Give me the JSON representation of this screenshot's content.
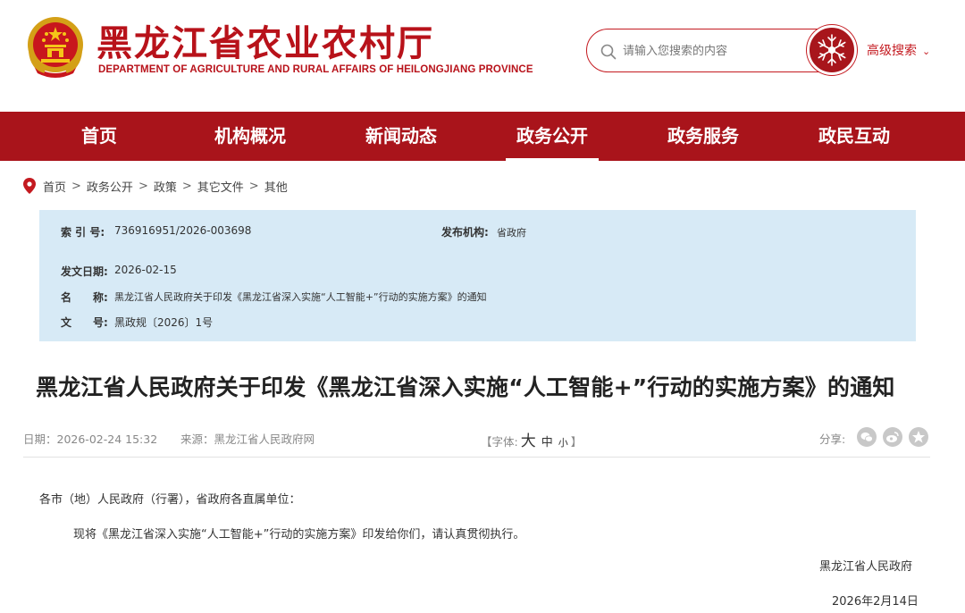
{
  "header": {
    "title": "黑龙江省农业农村厅",
    "subtitle": "DEPARTMENT OF AGRICULTURE AND RURAL AFFAIRS OF HEILONGJIANG PROVINCE",
    "emblem_icon": "national-emblem-icon",
    "search_placeholder": "请输入您搜索的内容",
    "advanced_search": "高级搜索",
    "brand_color": "#a9141b"
  },
  "nav": {
    "items": [
      {
        "label": "首页"
      },
      {
        "label": "机构概况"
      },
      {
        "label": "新闻动态"
      },
      {
        "label": "政务公开"
      },
      {
        "label": "政务服务"
      },
      {
        "label": "政民互动"
      }
    ],
    "active": "政务公开"
  },
  "breadcrumb": [
    "首页",
    "政务公开",
    "政策",
    "其它文件",
    "其他"
  ],
  "info": {
    "index_label": "索 引 号:",
    "index_value": "736916951/2026-003698",
    "publisher_label": "发布机构:",
    "publisher_value": "省政府",
    "date_label": "发文日期:",
    "date_value": "2026-02-15",
    "name_label": "名　　称:",
    "name_value": "黑龙江省人民政府关于印发《黑龙江省深入实施“人工智能+”行动的实施方案》的通知",
    "doc_label": "文　　号:",
    "doc_value": "黑政规〔2026〕1号",
    "bg_color": "#d7eaf6"
  },
  "article": {
    "title": "黑龙江省人民政府关于印发《黑龙江省深入实施“人工智能+”行动的实施方案》的通知",
    "date": "日期：2026-02-24 15:32",
    "source": "来源：黑龙江省人民政府网",
    "font_prefix": "【字体:",
    "font_large": "大",
    "font_medium": "中",
    "font_small": "小",
    "font_suffix": "】",
    "share_label": "分享:",
    "salutation": "各市（地）人民政府（行署），省政府各直属单位：",
    "paragraph": "现将《黑龙江省深入实施“人工智能+”行动的实施方案》印发给你们，请认真贯彻执行。",
    "signature": "黑龙江省人民政府",
    "sign_date": "2026年2月14日"
  }
}
